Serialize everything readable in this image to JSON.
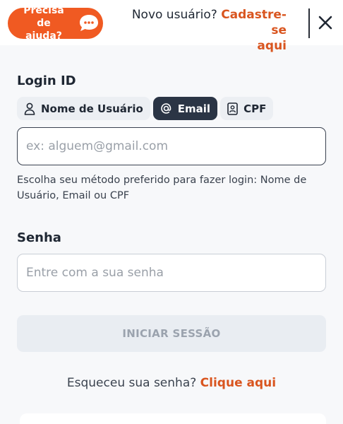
{
  "help": {
    "label": "Precisa de ajuda?",
    "label_line1": "Precisa de",
    "label_line2": "ajuda?"
  },
  "signup": {
    "prompt": "Novo usuário?",
    "link": "Cadastre-se aqui",
    "link_line1": "Cadastre-se",
    "link_line2": "aqui"
  },
  "login": {
    "title": "Login ID",
    "methods": [
      {
        "label": "Nome de Usuário",
        "icon": "user-icon",
        "active": false
      },
      {
        "label": "Email",
        "icon": "at-icon",
        "active": true
      },
      {
        "label": "CPF",
        "icon": "id-card-icon",
        "active": false
      }
    ],
    "email_placeholder": "ex: alguem@gmail.com",
    "email_value": "",
    "hint": "Escolha seu método preferido para fazer login: Nome de Usuário, Email ou CPF"
  },
  "password": {
    "title": "Senha",
    "placeholder": "Entre com a sua senha",
    "value": ""
  },
  "submit": {
    "label": "INICIAR SESSÃO",
    "enabled": false
  },
  "forgot": {
    "prompt": "Esqueceu sua senha?",
    "link": "Clique aqui"
  },
  "colors": {
    "accent": "#d9551f",
    "help_bg": "#f05a22",
    "active_tab": "#2b3545"
  }
}
